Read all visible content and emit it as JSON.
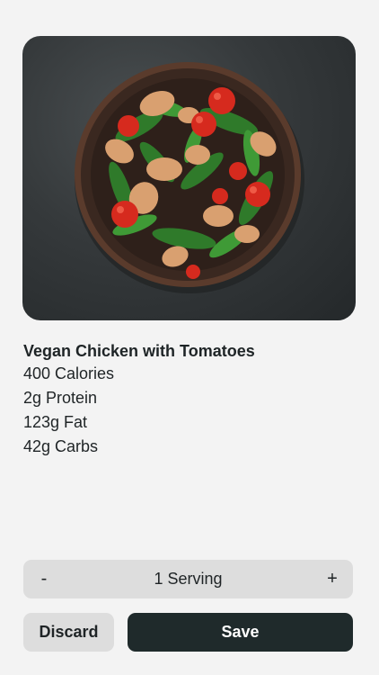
{
  "meal": {
    "name": "Vegan Chicken with Tomatoes",
    "calories": "400 Calories",
    "protein": "2g Protein",
    "fat": "123g Fat",
    "carbs": "42g Carbs"
  },
  "serving": {
    "decrement_label": "-",
    "label": "1 Serving",
    "increment_label": "+"
  },
  "actions": {
    "discard_label": "Discard",
    "save_label": "Save"
  },
  "colors": {
    "background": "#f3f3f3",
    "secondary_button": "#dddddd",
    "primary_button": "#1f2a2b",
    "text": "#1f2426"
  }
}
